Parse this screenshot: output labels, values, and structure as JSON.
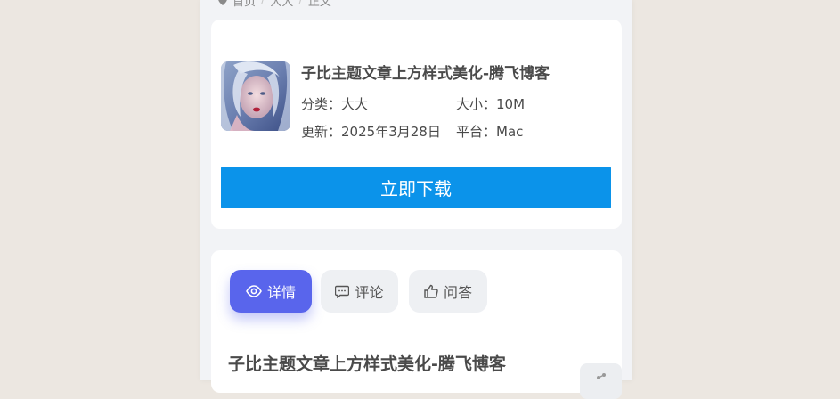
{
  "breadcrumb": {
    "home": "首页",
    "category": "大大",
    "current": "正文"
  },
  "app": {
    "title": "子比主题文章上方样式美化-腾飞博客",
    "category_label": "分类：",
    "category_value": "大大",
    "size_label": "大小：",
    "size_value": "10M",
    "updated_label": "更新：",
    "updated_value": "2025年3月28日",
    "platform_label": "平台：",
    "platform_value": "Mac"
  },
  "download": {
    "label": "立即下载",
    "color": "#0b93ea"
  },
  "tabs": [
    {
      "label": "详情",
      "icon": "eye-icon",
      "active": true
    },
    {
      "label": "评论",
      "icon": "comment-icon",
      "active": false
    },
    {
      "label": "问答",
      "icon": "thumbs-up-icon",
      "active": false
    }
  ],
  "article": {
    "title": "子比主题文章上方样式美化-腾飞博客"
  },
  "colors": {
    "accent": "#5965ec",
    "download": "#0b93ea",
    "page_bg": "#ece7e1"
  }
}
